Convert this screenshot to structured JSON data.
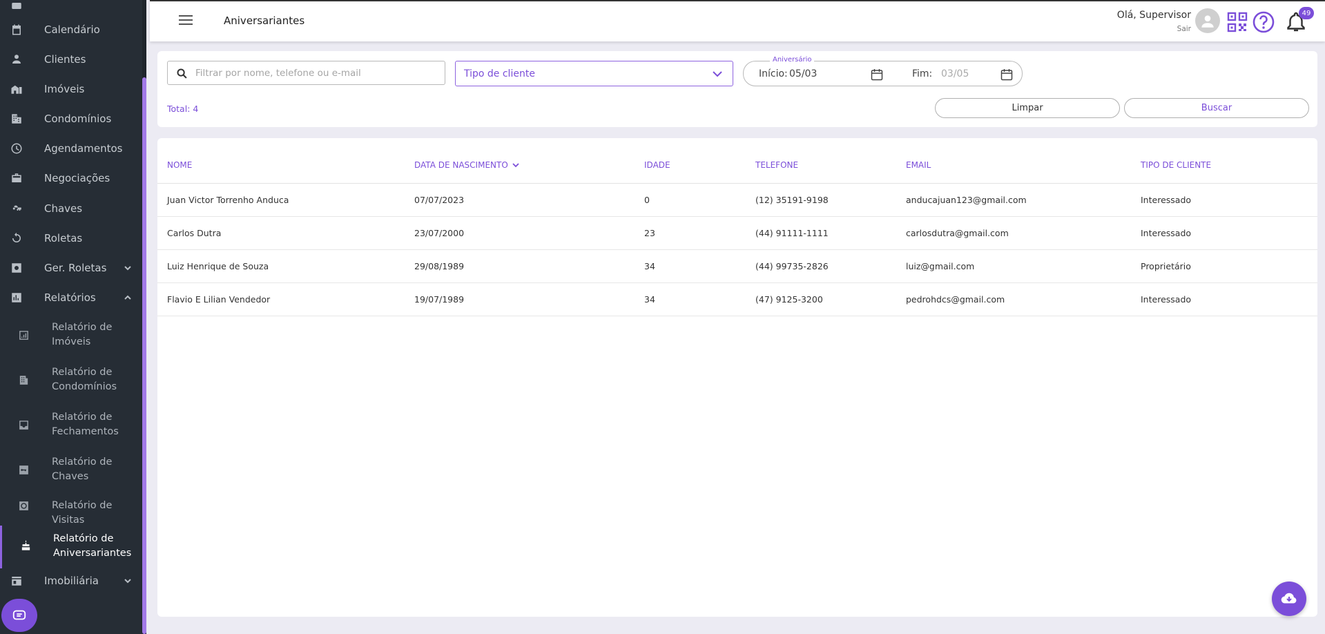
{
  "sidebar": {
    "items": [
      {
        "label": "Calendário",
        "icon": "calendar-icon"
      },
      {
        "label": "Clientes",
        "icon": "person-icon"
      },
      {
        "label": "Imóveis",
        "icon": "buildings-icon"
      },
      {
        "label": "Condomínios",
        "icon": "apartment-icon"
      },
      {
        "label": "Agendamentos",
        "icon": "clock-icon"
      },
      {
        "label": "Negociações",
        "icon": "briefcase-icon"
      },
      {
        "label": "Chaves",
        "icon": "key-icon"
      },
      {
        "label": "Roletas",
        "icon": "refresh-icon"
      },
      {
        "label": "Ger. Roletas",
        "icon": "gear-box-icon"
      },
      {
        "label": "Relatórios",
        "icon": "bar-chart-icon"
      },
      {
        "label": "Imobiliária",
        "icon": "store-icon"
      }
    ],
    "reports": [
      {
        "label": "Relatório de Imóveis",
        "icon": "chart-building-icon"
      },
      {
        "label": "Relatório de Condomínios",
        "icon": "building-icon"
      },
      {
        "label": "Relatório de Fechamentos",
        "icon": "inbox-icon"
      },
      {
        "label": "Relatório de Chaves",
        "icon": "key-box-icon"
      },
      {
        "label": "Relatório de Visitas",
        "icon": "visit-icon"
      },
      {
        "label": "Relatório de Aniversariantes",
        "icon": "cake-icon"
      }
    ]
  },
  "header": {
    "title": "Aniversariantes",
    "greeting": "Olá, Supervisor",
    "logout": "Sair",
    "notifications_count": "49"
  },
  "filters": {
    "search_placeholder": "Filtrar por nome, telefone ou e-mail",
    "client_type": "Tipo de cliente",
    "date_legend": "Aniversário",
    "start_label": "Início:",
    "start_value": "05/03",
    "end_label": "Fim:",
    "end_value": "03/05",
    "total": "Total: 4",
    "clear_label": "Limpar",
    "search_label": "Buscar"
  },
  "table": {
    "headers": [
      "NOME",
      "DATA DE NASCIMENTO",
      "IDADE",
      "TELEFONE",
      "EMAIL",
      "TIPO DE CLIENTE"
    ],
    "rows": [
      [
        "Juan Victor Torrenho Anduca",
        "07/07/2023",
        "0",
        "(12) 35191-9198",
        "anducajuan123@gmail.com",
        "Interessado"
      ],
      [
        "Carlos Dutra",
        "23/07/2000",
        "23",
        "(44) 91111-1111",
        "carlosdutra@gmail.com",
        "Interessado"
      ],
      [
        "Luiz Henrique de Souza",
        "29/08/1989",
        "34",
        "(44) 99735-2826",
        "luiz@gmail.com",
        "Proprietário"
      ],
      [
        "Flavio E Lilian Vendedor",
        "19/07/1989",
        "34",
        "(47) 9125-3200",
        "pedrohdcs@gmail.com",
        "Interessado"
      ]
    ]
  },
  "colors": {
    "accent": "#7b4ed9",
    "sidebar_bg": "#262d35",
    "page_bg": "#ecebf3"
  }
}
